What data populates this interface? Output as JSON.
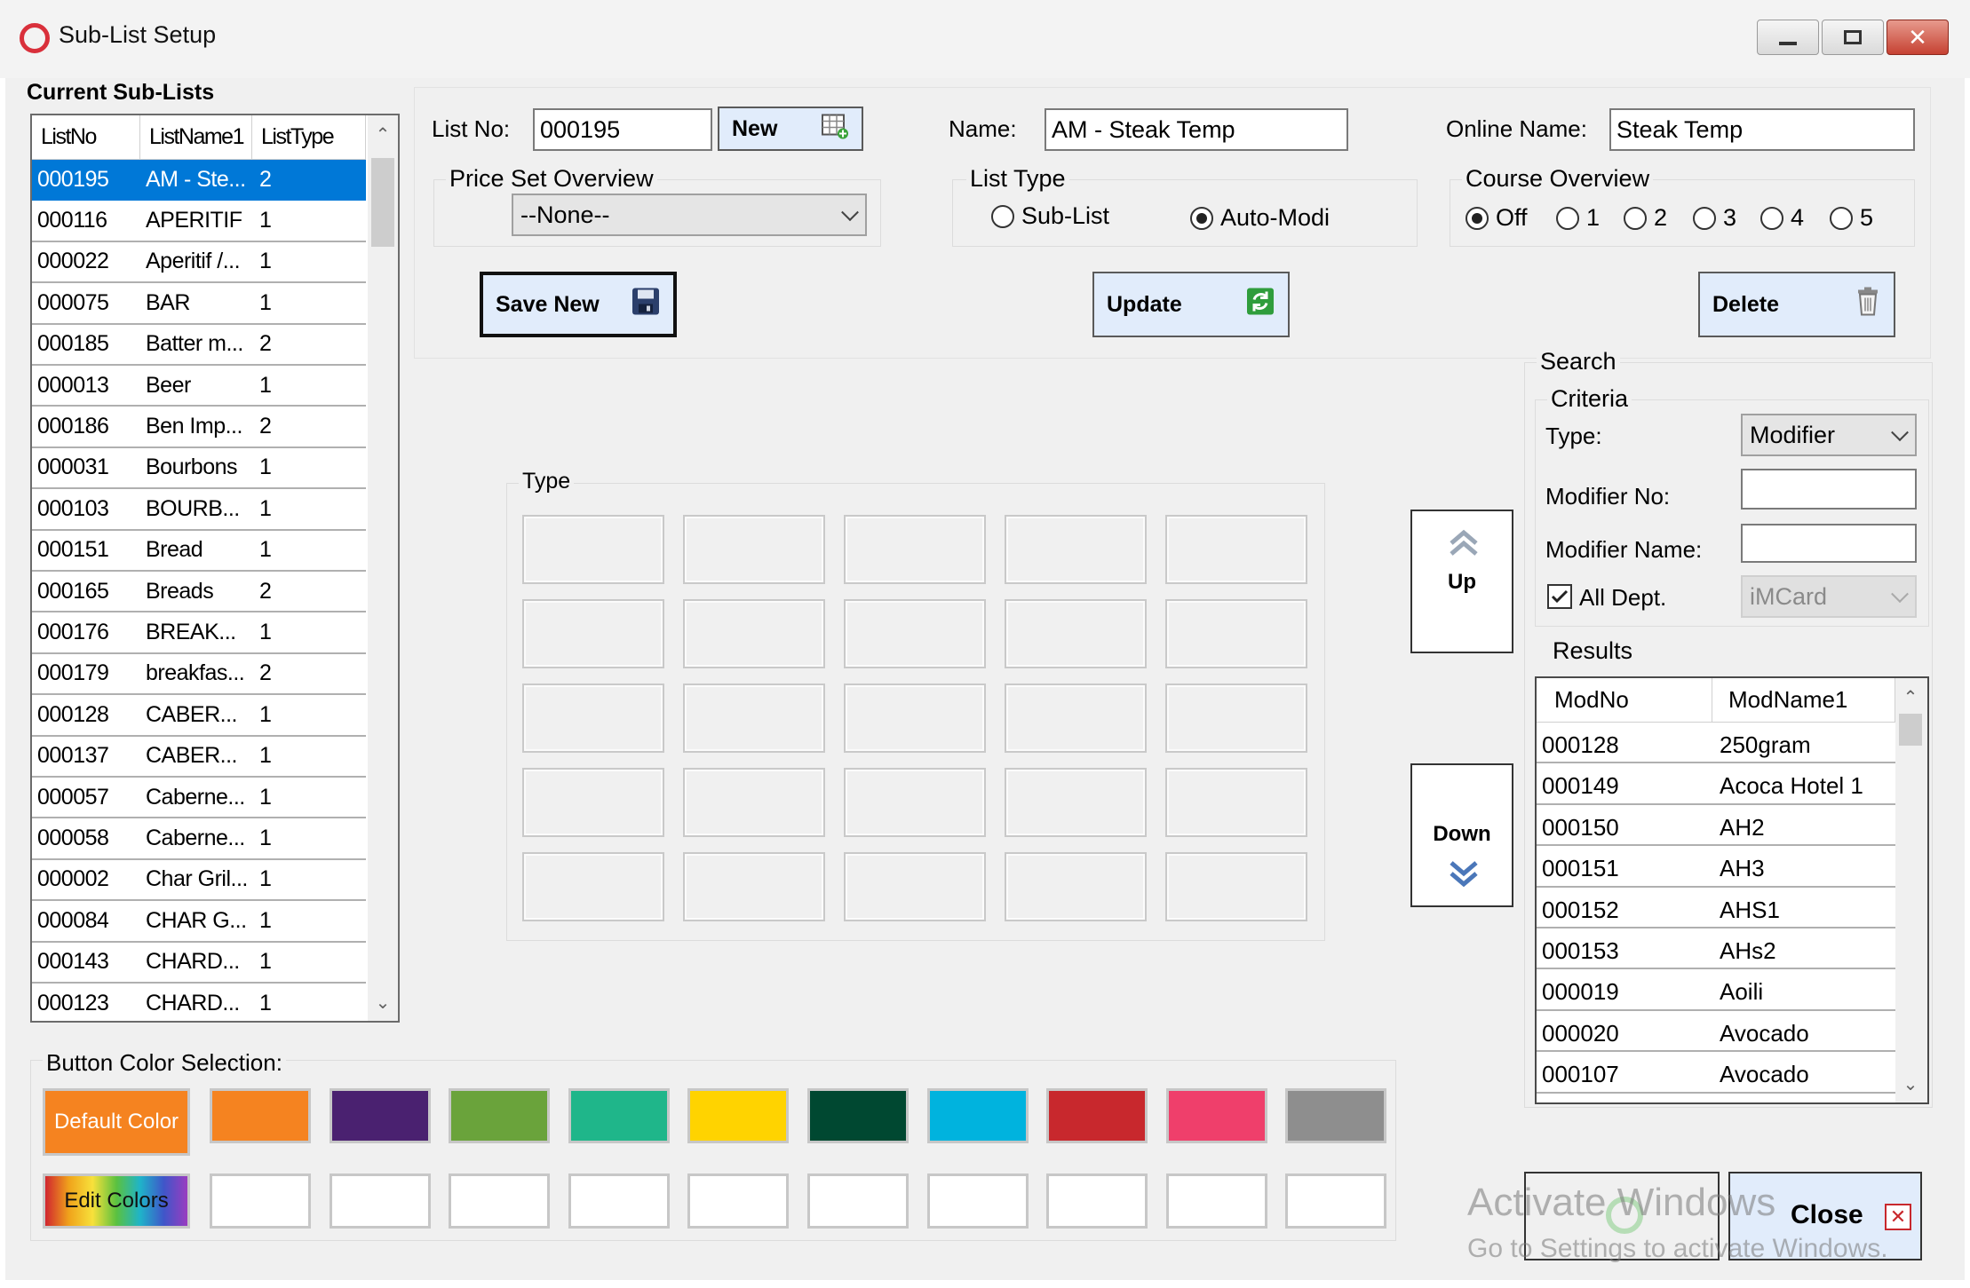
{
  "window": {
    "title": "Sub-List Setup"
  },
  "current_sublists": {
    "label": "Current Sub-Lists",
    "columns": [
      "ListNo",
      "ListName1",
      "ListType"
    ],
    "rows": [
      {
        "no": "000195",
        "name": "AM - Ste...",
        "type": "2"
      },
      {
        "no": "000116",
        "name": "APERITIF",
        "type": "1"
      },
      {
        "no": "000022",
        "name": "Aperitif /...",
        "type": "1"
      },
      {
        "no": "000075",
        "name": "BAR",
        "type": "1"
      },
      {
        "no": "000185",
        "name": "Batter m...",
        "type": "2"
      },
      {
        "no": "000013",
        "name": "Beer",
        "type": "1"
      },
      {
        "no": "000186",
        "name": "Ben Imp...",
        "type": "2"
      },
      {
        "no": "000031",
        "name": "Bourbons",
        "type": "1"
      },
      {
        "no": "000103",
        "name": "BOURB...",
        "type": "1"
      },
      {
        "no": "000151",
        "name": "Bread",
        "type": "1"
      },
      {
        "no": "000165",
        "name": "Breads",
        "type": "2"
      },
      {
        "no": "000176",
        "name": "BREAK...",
        "type": "1"
      },
      {
        "no": "000179",
        "name": "breakfas...",
        "type": "2"
      },
      {
        "no": "000128",
        "name": "CABER...",
        "type": "1"
      },
      {
        "no": "000137",
        "name": "CABER...",
        "type": "1"
      },
      {
        "no": "000057",
        "name": "Caberne...",
        "type": "1"
      },
      {
        "no": "000058",
        "name": "Caberne...",
        "type": "1"
      },
      {
        "no": "000002",
        "name": "Char Gril...",
        "type": "1"
      },
      {
        "no": "000084",
        "name": "CHAR G...",
        "type": "1"
      },
      {
        "no": "000143",
        "name": "CHARD...",
        "type": "1"
      },
      {
        "no": "000123",
        "name": "CHARD...",
        "type": "1"
      }
    ]
  },
  "form": {
    "list_no_label": "List No:",
    "list_no": "000195",
    "new_label": "New",
    "name_label": "Name:",
    "name": "AM - Steak Temp",
    "online_name_label": "Online Name:",
    "online_name": "Steak Temp",
    "price_set_label": "Price Set Overview",
    "price_set_value": "--None--",
    "list_type_label": "List Type",
    "list_type_options": [
      "Sub-List",
      "Auto-Modi"
    ],
    "course_label": "Course Overview",
    "course_options": [
      "Off",
      "1",
      "2",
      "3",
      "4",
      "5"
    ],
    "save_new_label": "Save New",
    "update_label": "Update",
    "delete_label": "Delete"
  },
  "type_section": {
    "label": "Type"
  },
  "move": {
    "up_label": "Up",
    "down_label": "Down"
  },
  "search": {
    "label": "Search",
    "criteria_label": "Criteria",
    "type_label": "Type:",
    "type_value": "Modifier",
    "modifier_no_label": "Modifier No:",
    "modifier_name_label": "Modifier Name:",
    "all_dept_label": "All Dept.",
    "dept_value": "iMCard",
    "results_label": "Results",
    "columns": [
      "ModNo",
      "ModName1"
    ],
    "rows": [
      {
        "no": "000128",
        "name": "250gram"
      },
      {
        "no": "000149",
        "name": "Acoca Hotel 1"
      },
      {
        "no": "000150",
        "name": "AH2"
      },
      {
        "no": "000151",
        "name": "AH3"
      },
      {
        "no": "000152",
        "name": "AHS1"
      },
      {
        "no": "000153",
        "name": "AHs2"
      },
      {
        "no": "000019",
        "name": "Aoili"
      },
      {
        "no": "000020",
        "name": "Avocado"
      },
      {
        "no": "000107",
        "name": "Avocado"
      }
    ]
  },
  "colors": {
    "label": "Button Color Selection:",
    "default_label": "Default Color",
    "edit_label": "Edit Colors",
    "default_color": "#f58320",
    "palette": [
      "#f58320",
      "#4a2170",
      "#6aa33b",
      "#1fb68a",
      "#ffd300",
      "#004831",
      "#00b3de",
      "#c8282d",
      "#ef3f6b",
      "#8e8e8e"
    ]
  },
  "footer": {
    "close_label": "Close",
    "watermark_title": "Activate Windows",
    "watermark_sub": "Go to Settings to activate Windows."
  }
}
